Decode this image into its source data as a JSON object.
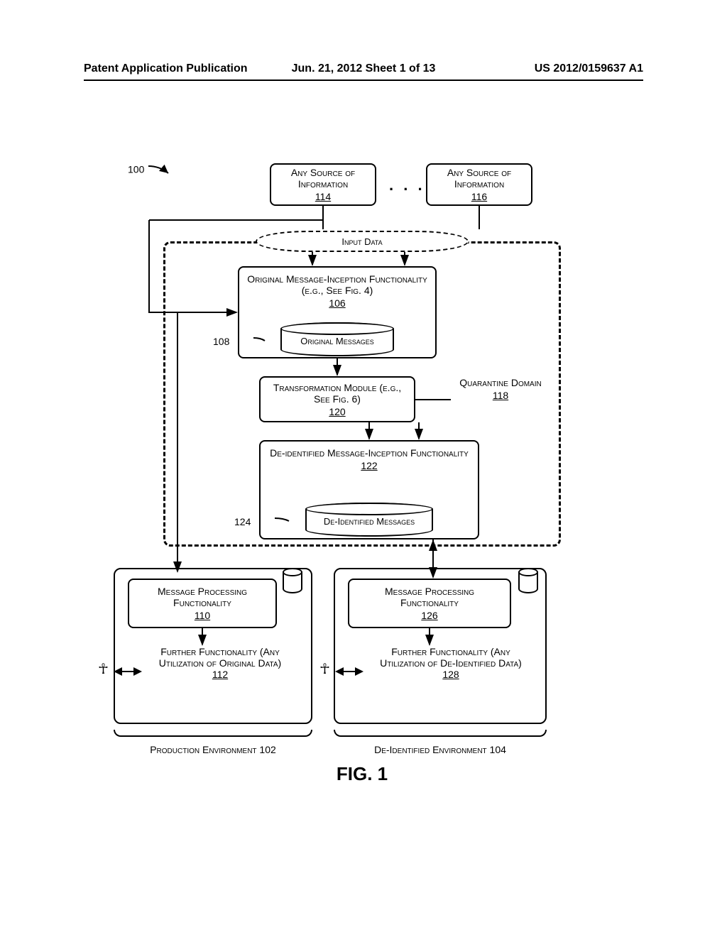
{
  "header": {
    "left": "Patent Application Publication",
    "mid": "Jun. 21, 2012  Sheet 1 of 13",
    "right": "US 2012/0159637 A1"
  },
  "figure": {
    "ref100": "100",
    "source1": {
      "title": "Any Source of Information",
      "ref": "114"
    },
    "source2": {
      "title": "Any Source of Information",
      "ref": "116"
    },
    "dots": ". . .",
    "input_data": "Input Data",
    "omif": {
      "title": "Original Message-Inception Functionality (e.g., See Fig. 4)",
      "ref": "106"
    },
    "orig_msgs": {
      "title": "Original Messages",
      "ref": "108"
    },
    "transform": {
      "title": "Transformation Module (e.g., See Fig. 6)",
      "ref": "120"
    },
    "quarantine": {
      "title": "Quarantine Domain",
      "ref": "118"
    },
    "dmif": {
      "title": "De-identified Message-Inception Functionality",
      "ref": "122"
    },
    "deid_msgs": {
      "title": "De-Identified Messages",
      "ref": "124"
    },
    "mpf_left": {
      "title": "Message Processing Functionality",
      "ref": "110"
    },
    "ff_left": {
      "title": "Further Functionality (Any Utilization of Original Data)",
      "ref": "112"
    },
    "mpf_right": {
      "title": "Message Processing Functionality",
      "ref": "126"
    },
    "ff_right": {
      "title": "Further Functionality (Any Utilization of De-Identified Data)",
      "ref": "128"
    },
    "env_prod": "Production Environment 102",
    "env_deid": "De-Identified Environment 104",
    "fig_num": "FIG. 1"
  }
}
